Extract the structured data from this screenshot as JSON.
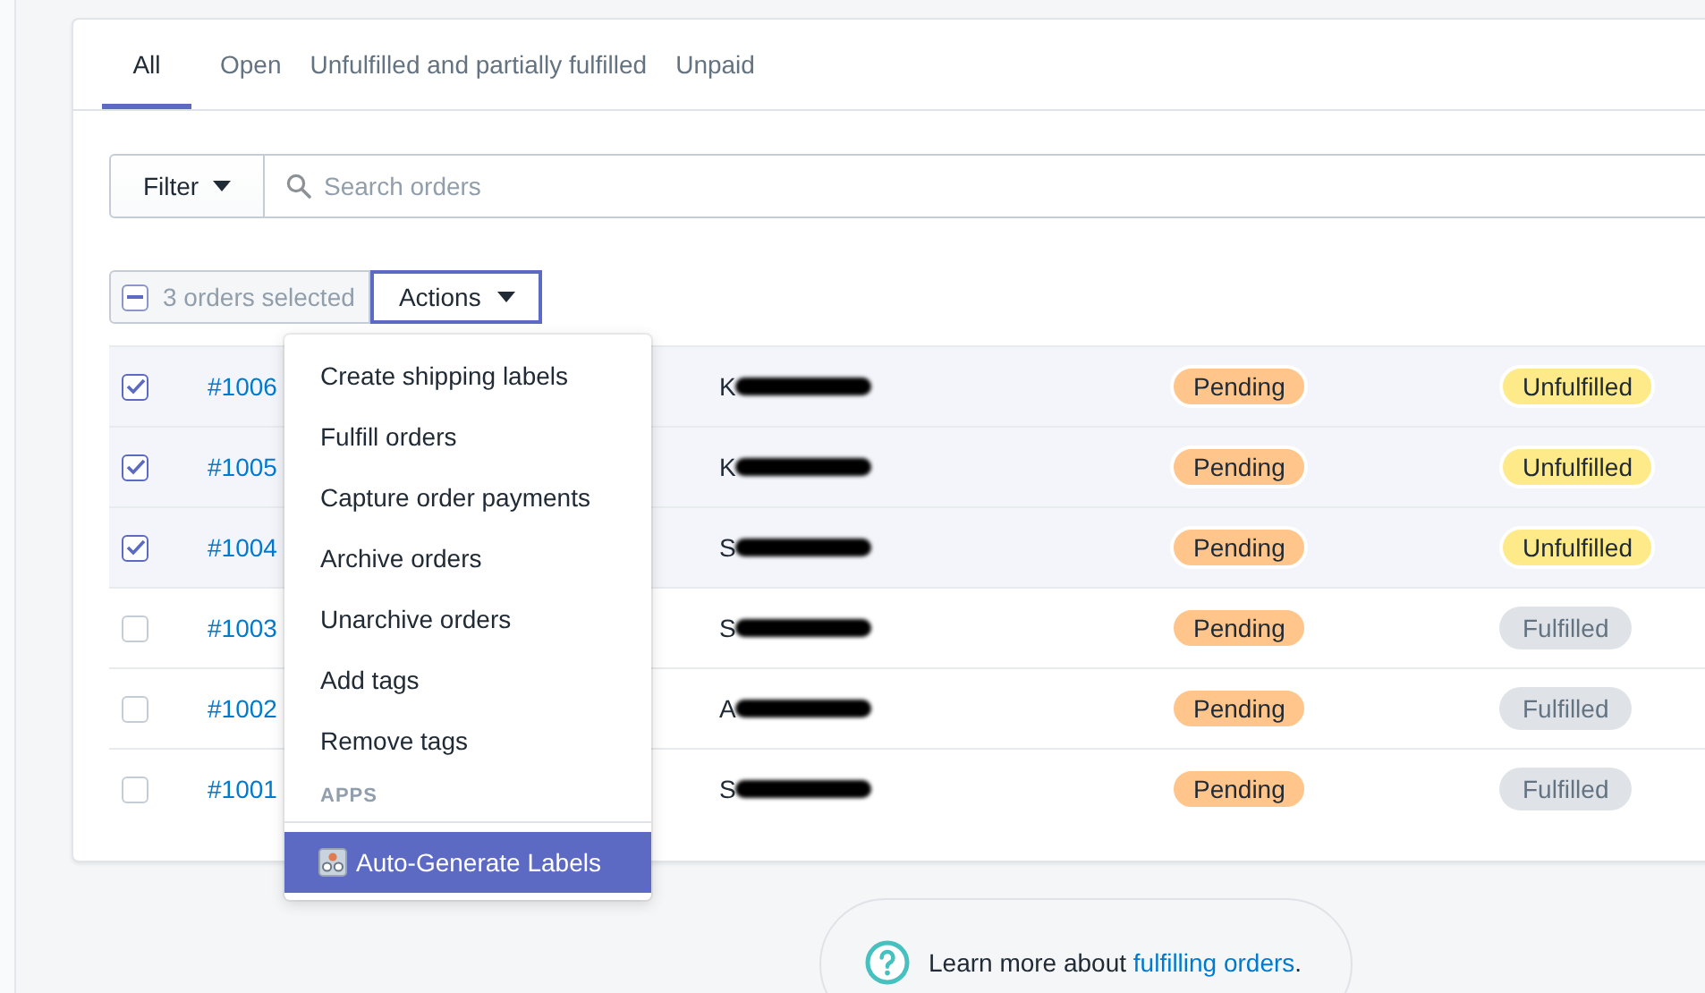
{
  "tabs": [
    {
      "label": "All",
      "selected": true
    },
    {
      "label": "Open",
      "selected": false
    },
    {
      "label": "Unfulfilled and partially fulfilled",
      "selected": false
    },
    {
      "label": "Unpaid",
      "selected": false
    }
  ],
  "filter": {
    "label": "Filter"
  },
  "search": {
    "placeholder": "Search orders"
  },
  "bulk": {
    "label": "3 orders selected",
    "indeterminate": true
  },
  "actions": {
    "label": "Actions",
    "open": true
  },
  "menu": {
    "items": [
      {
        "label": "Create shipping labels"
      },
      {
        "label": "Fulfill orders"
      },
      {
        "label": "Capture order payments"
      },
      {
        "label": "Archive orders"
      },
      {
        "label": "Unarchive orders"
      },
      {
        "label": "Add tags"
      },
      {
        "label": "Remove tags"
      }
    ],
    "section": "APPS",
    "apps": [
      {
        "label": "Auto-Generate Labels",
        "selected": true
      }
    ]
  },
  "orders": [
    {
      "number": "#1006",
      "selected": true,
      "customer": "K",
      "payment": {
        "label": "Pending",
        "kind": "pending"
      },
      "fulfillment": {
        "label": "Unfulfilled",
        "kind": "unfulfilled"
      }
    },
    {
      "number": "#1005",
      "selected": true,
      "customer": "K",
      "payment": {
        "label": "Pending",
        "kind": "pending"
      },
      "fulfillment": {
        "label": "Unfulfilled",
        "kind": "unfulfilled"
      }
    },
    {
      "number": "#1004",
      "selected": true,
      "customer": "S",
      "payment": {
        "label": "Pending",
        "kind": "pending"
      },
      "fulfillment": {
        "label": "Unfulfilled",
        "kind": "unfulfilled"
      }
    },
    {
      "number": "#1003",
      "selected": false,
      "customer": "S",
      "payment": {
        "label": "Pending",
        "kind": "pending"
      },
      "fulfillment": {
        "label": "Fulfilled",
        "kind": "fulfilled"
      }
    },
    {
      "number": "#1002",
      "selected": false,
      "customer": "A",
      "payment": {
        "label": "Pending",
        "kind": "pending"
      },
      "fulfillment": {
        "label": "Fulfilled",
        "kind": "fulfilled"
      }
    },
    {
      "number": "#1001",
      "selected": false,
      "customer": "S",
      "payment": {
        "label": "Pending",
        "kind": "pending"
      },
      "fulfillment": {
        "label": "Fulfilled",
        "kind": "fulfilled"
      }
    }
  ],
  "help": {
    "text": "Learn more about ",
    "link": "fulfilling orders",
    "after": "."
  }
}
